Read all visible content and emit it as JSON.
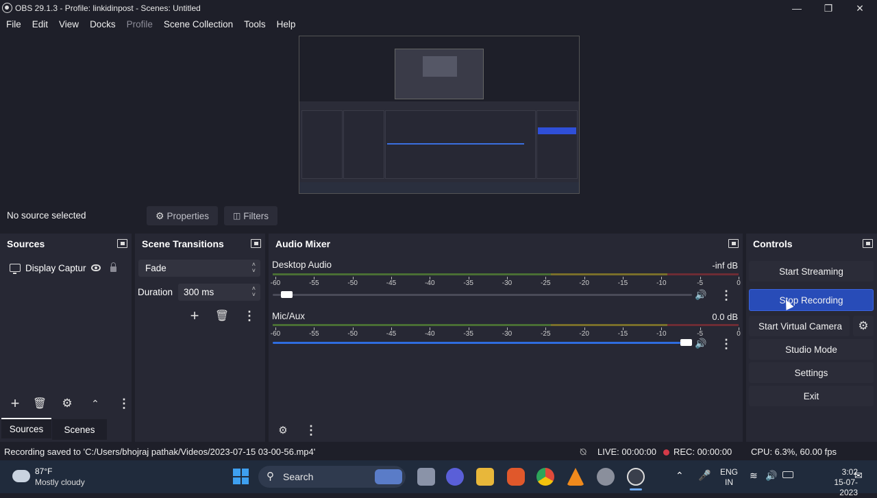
{
  "window": {
    "title": "OBS 29.1.3 - Profile: linkidinpost - Scenes: Untitled"
  },
  "menu": [
    "File",
    "Edit",
    "View",
    "Docks",
    "Profile",
    "Scene Collection",
    "Tools",
    "Help"
  ],
  "source_toolbar": {
    "status": "No source selected",
    "properties": "Properties",
    "filters": "Filters"
  },
  "sources": {
    "title": "Sources",
    "items": [
      {
        "label": "Display Captur",
        "icon": "monitor-icon"
      }
    ],
    "tabs": [
      "Sources",
      "Scenes"
    ]
  },
  "transitions": {
    "title": "Scene Transitions",
    "selected": "Fade",
    "duration_label": "Duration",
    "duration_value": "300 ms"
  },
  "mixer": {
    "title": "Audio Mixer",
    "scale": [
      "-60",
      "-55",
      "-50",
      "-45",
      "-40",
      "-35",
      "-30",
      "-25",
      "-20",
      "-15",
      "-10",
      "-5",
      "0"
    ],
    "channels": [
      {
        "name": "Desktop Audio",
        "db": "-inf dB",
        "volume": 0.02
      },
      {
        "name": "Mic/Aux",
        "db": "0.0 dB",
        "volume": 1.0
      }
    ]
  },
  "controls": {
    "title": "Controls",
    "start_streaming": "Start Streaming",
    "stop_recording": "Stop Recording",
    "start_virtual_camera": "Start Virtual Camera",
    "studio_mode": "Studio Mode",
    "settings": "Settings",
    "exit": "Exit"
  },
  "status": {
    "message": "Recording saved to 'C:/Users/bhojraj pathak/Videos/2023-07-15 03-00-56.mp4'",
    "live": "LIVE: 00:00:00",
    "rec": "REC: 00:00:00",
    "cpu": "CPU: 6.3%, 60.00 fps"
  },
  "taskbar": {
    "weather_temp": "87°F",
    "weather_desc": "Mostly cloudy",
    "search": "Search",
    "lang_line1": "ENG",
    "lang_line2": "IN",
    "time": "3:02",
    "date": "15-07-2023"
  },
  "colors": {
    "accent": "#284cb8",
    "dock_bg": "#272834",
    "window_bg": "#1e1f29",
    "rec_dot": "#d43a48"
  }
}
